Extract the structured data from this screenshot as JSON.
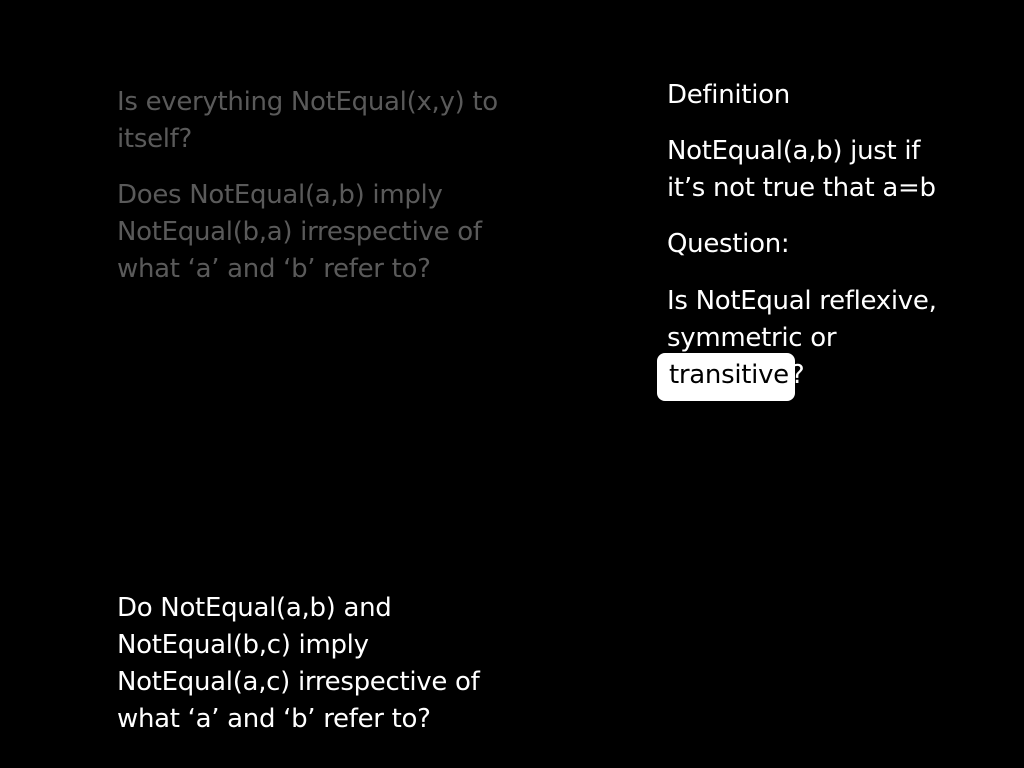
{
  "left_questions": {
    "q1": [
      "Is everything NotEqual(x,y) to",
      "itself?"
    ],
    "q2": [
      "Does NotEqual(a,b) imply",
      "NotEqual(b,a) irrespective of",
      "what ‘a’ and ‘b’ refer to?"
    ],
    "q3": [
      "Do NotEqual(a,b) and",
      "NotEqual(b,c) imply",
      "NotEqual(a,c) irrespective of",
      "what ‘a’ and ‘b’ refer to?"
    ]
  },
  "right_panel": {
    "definition_heading": "Definition",
    "definition_text": [
      "NotEqual(a,b) just if",
      "it’s not true that a=b"
    ],
    "question_heading": "Question:",
    "question_line1": "Is NotEqual reflexive,",
    "question_line2": "symmetric or",
    "highlighted_word": "transitive",
    "question_mark": "?"
  },
  "colors": {
    "background": "#000000",
    "dim_text": "#5a5a5a",
    "bright_text": "#ffffff",
    "highlight_box": "#ffffff"
  }
}
